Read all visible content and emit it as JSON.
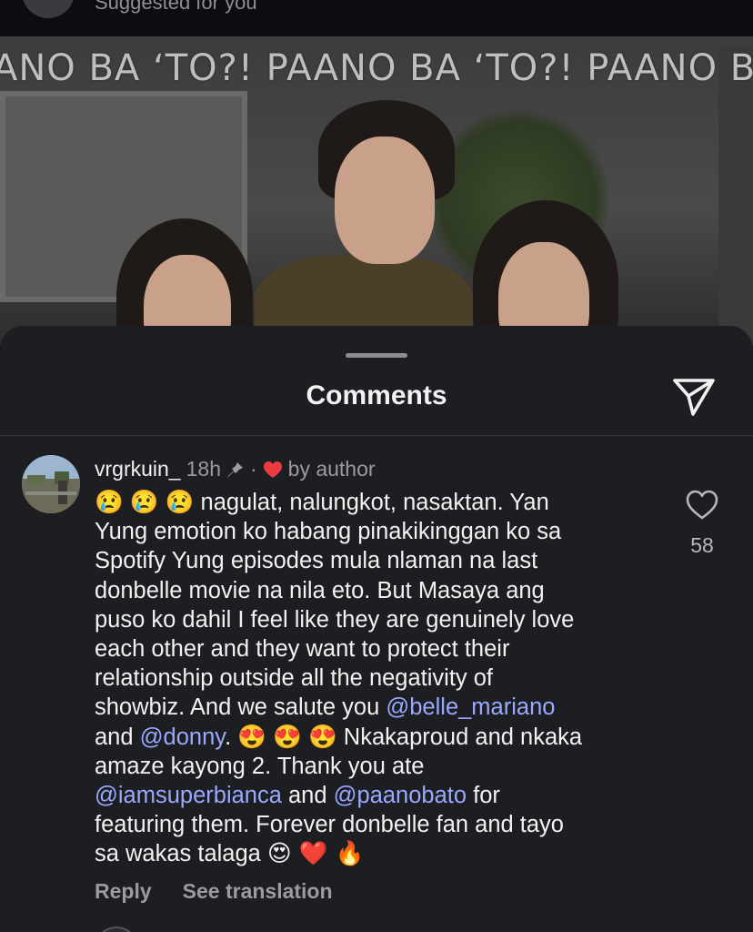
{
  "top_strip": {
    "suggested_text": "Suggested for you"
  },
  "video": {
    "banner_text": "ANO BA ‘TO?!   PAANO BA ‘TO?!   PAANO BA"
  },
  "sheet": {
    "title": "Comments",
    "share_icon": "send-icon"
  },
  "comment": {
    "username": "vrgrkuin_",
    "time": "18h",
    "pin_icon": "pin-icon",
    "separator": "·",
    "liked_by_author_icon": "heart-icon",
    "liked_by_author_text": "by author",
    "lines": [
      [
        "😢 😢 😢  nagulat, nalungkot, nasaktan. Yan"
      ],
      [
        "Yung emotion ko habang pinakikinggan ko sa"
      ],
      [
        "Spotify Yung episodes mula nlaman na last"
      ],
      [
        "donbelle movie na nila eto. But Masaya ang"
      ],
      [
        "puso ko dahil I feel like they are genuinely love"
      ],
      [
        "each other and they want to protect their"
      ],
      [
        "relationship outside all the negativity of"
      ],
      [
        "showbiz. And we salute you ",
        "@belle_mariano"
      ],
      [
        "and ",
        "@donny",
        ". 😍 😍 😍  Nkakaproud and nkaka"
      ],
      [
        "amaze kayong 2. Thank you ate"
      ],
      [
        "@iamsuperbianca",
        " and ",
        "@paanobato",
        " for"
      ],
      [
        "featuring them. Forever donbelle fan and tayo"
      ],
      [
        "sa wakas talaga ",
        "😍 ❤️ 🔥"
      ]
    ],
    "like_count": "58",
    "reply_label": "Reply",
    "translate_label": "See translation"
  },
  "colors": {
    "sheet_bg": "#1c1e21",
    "mention": "#9aa9ff",
    "heart_red": "#ed3b42",
    "text_primary": "#f2f2f2",
    "text_secondary": "#9a9ca1"
  }
}
